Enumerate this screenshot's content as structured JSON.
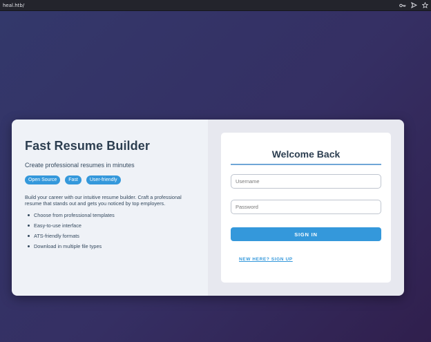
{
  "browser": {
    "url": "heal.htb/",
    "icons": [
      "key-icon",
      "send-icon",
      "star-icon"
    ]
  },
  "app": {
    "title": "Fast Resume Builder",
    "subtitle": "Create professional resumes in minutes",
    "tags": [
      "Open Source",
      "Fast",
      "User-friendly"
    ],
    "description": "Build your career with our intuitive resume builder. Craft a professional resume that stands out and gets you noticed by top employers.",
    "features": [
      "Choose from professional templates",
      "Easy-to-use interface",
      "ATS-friendly formats",
      "Download in multiple file types"
    ]
  },
  "login": {
    "heading": "Welcome Back",
    "username_placeholder": "Username",
    "password_placeholder": "Password",
    "submit_label": "SIGN IN",
    "signup_link": "NEW HERE? SIGN UP"
  },
  "colors": {
    "accent": "#3498db",
    "title": "#2c3e50",
    "background_gradient": [
      "#33386b",
      "#301f4d"
    ]
  }
}
